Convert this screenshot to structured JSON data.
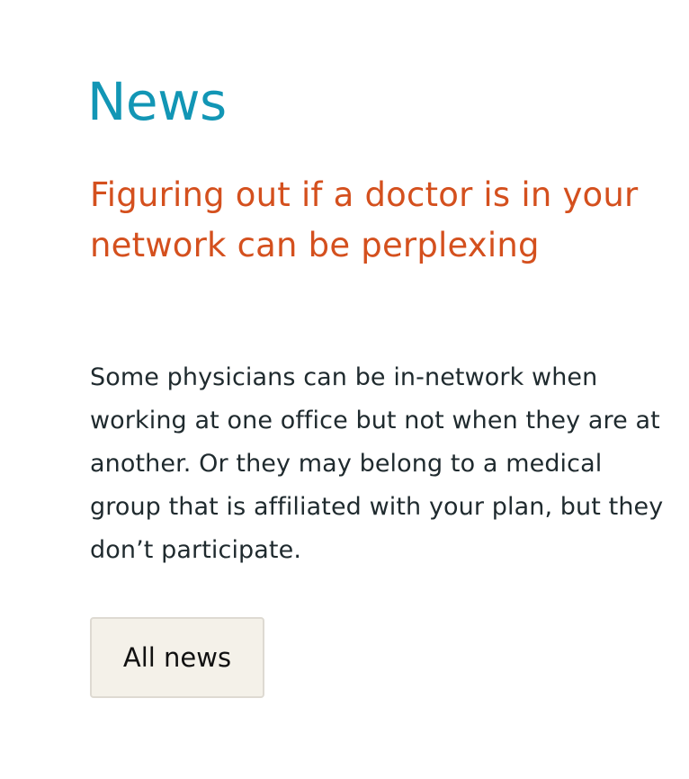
{
  "section": {
    "title": "News"
  },
  "article": {
    "headline": "Figuring out if a doctor is in your network can be perplexing",
    "summary": "Some physicians can be in-network when working at one office but not when they are at another. Or they may belong to a medical group that is affiliated with your plan, but they don’t participate."
  },
  "actions": {
    "all_news_label": "All news"
  },
  "colors": {
    "title": "#1296b5",
    "headline": "#d4501e",
    "body_text": "#1f2a2e",
    "button_background": "#f4f1e9",
    "button_border": "#dedad2"
  }
}
